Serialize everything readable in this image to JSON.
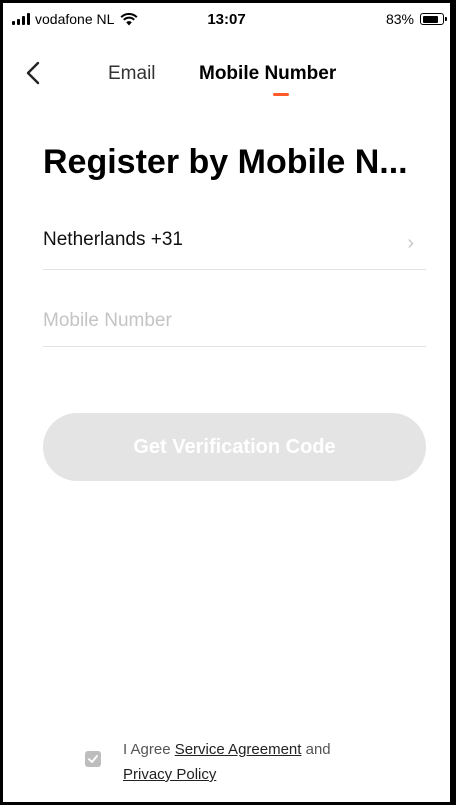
{
  "status_bar": {
    "carrier": "vodafone NL",
    "time": "13:07",
    "battery": "83%",
    "battery_level": 0.83
  },
  "nav": {
    "tab_email": "Email",
    "tab_mobile": "Mobile Number",
    "active_tab": "Mobile Number",
    "accent_color": "#ff5a28"
  },
  "page": {
    "title": "Register by Mobile N..."
  },
  "form": {
    "country": "Netherlands +31",
    "mobile_placeholder": "Mobile Number",
    "mobile_value": ""
  },
  "buttons": {
    "verify_label": "Get Verification Code"
  },
  "agreement": {
    "prefix": "I Agree ",
    "service_link": "Service Agreement",
    "and_text": " and",
    "privacy_link": "Privacy Policy",
    "checked": true
  }
}
